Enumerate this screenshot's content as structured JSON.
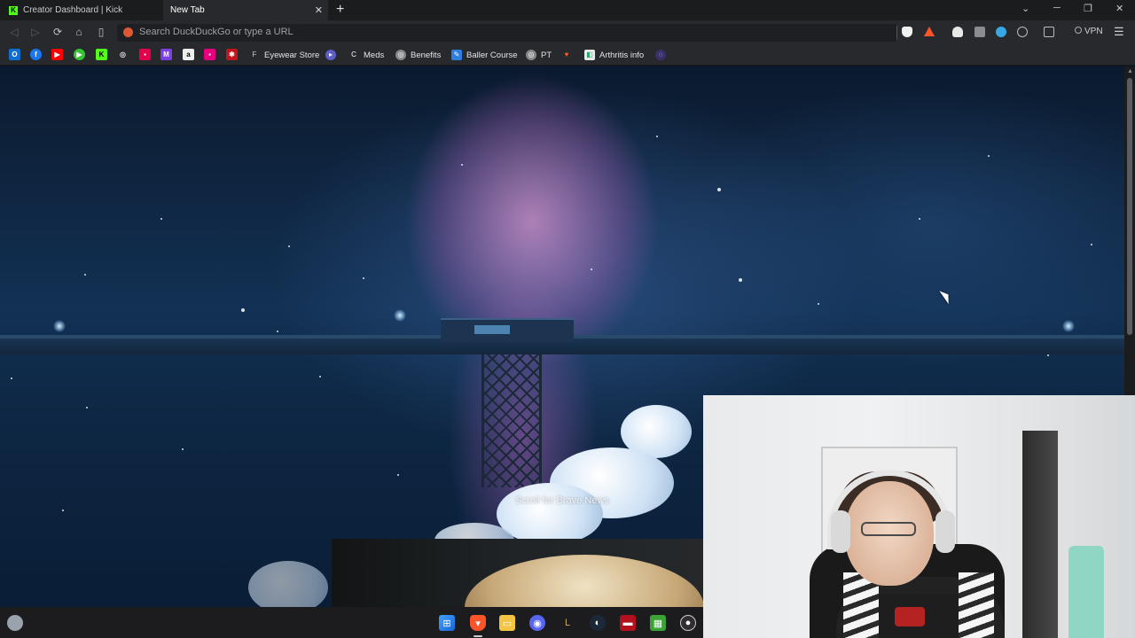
{
  "browser": {
    "tabs": [
      {
        "title": "Creator Dashboard | Kick",
        "active": false
      },
      {
        "title": "New Tab",
        "active": true
      }
    ],
    "address_bar": {
      "placeholder": "Search DuckDuckGo or type a URL"
    },
    "vpn_label": "VPN"
  },
  "bookmarks": {
    "labeled": [
      "Eyewear Store",
      "Meds",
      "Benefits",
      "Baller Course",
      "PT",
      "Arthritis info"
    ]
  },
  "new_tab_page": {
    "scroll_hint": "Scroll for Brave News"
  },
  "colors": {
    "kick_green": "#53fc18",
    "brave_orange": "#fb542b",
    "tab_bg": "#1b1c1e",
    "toolbar_bg": "#28292c"
  },
  "taskbar": {
    "icons": [
      "windows-start-icon",
      "brave-icon",
      "file-explorer-icon",
      "discord-icon",
      "league-icon",
      "steam-icon",
      "game-launcher-icon",
      "minecraft-icon",
      "obs-icon"
    ]
  }
}
